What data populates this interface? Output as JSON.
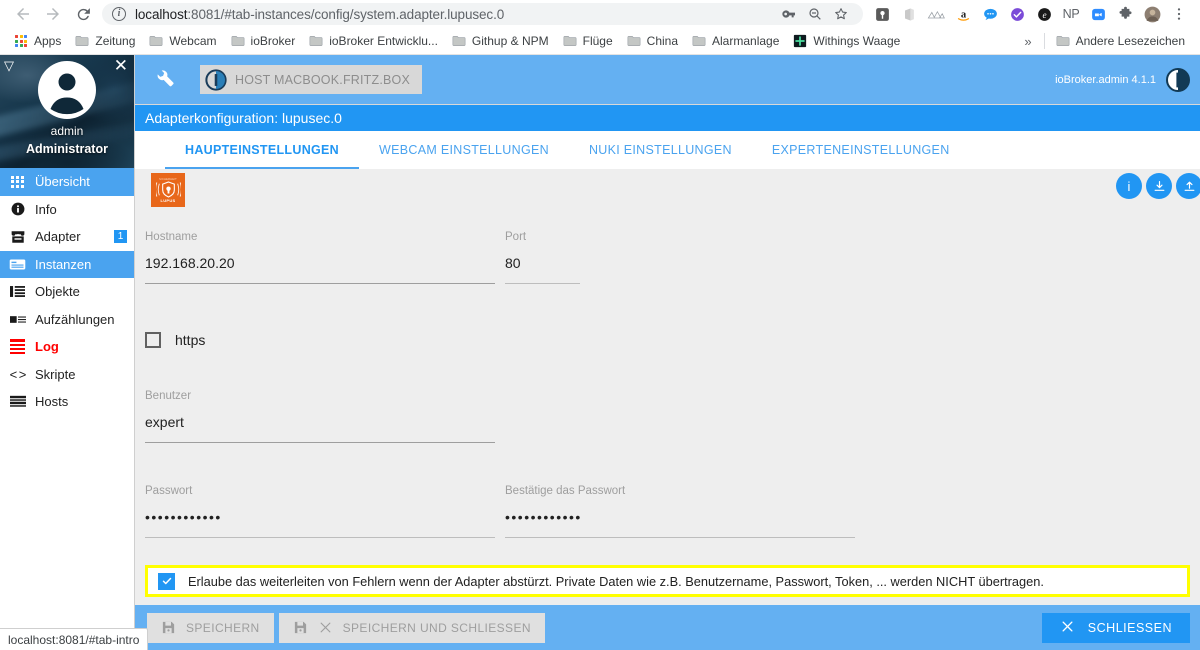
{
  "browser": {
    "nav": {
      "back": "←",
      "forward": "→",
      "reload": "⟳"
    },
    "url_prefix": "localhost",
    "url_suffix": ":8081/#tab-instances/config/system.adapter.lupusec.0",
    "omnibox_actions": [
      "key-icon",
      "zoom-out-icon",
      "bookmark-star-icon"
    ],
    "extensions": [
      "pocket-icon",
      "office-icon",
      "mountains-icon",
      "amazon-icon",
      "chat-bubble-icon",
      "check-circle-icon",
      "e-badge-icon",
      "np-icon",
      "zoom-video-icon",
      "puzzle-extension-icon",
      "profile-avatar-icon",
      "chrome-menu-icon"
    ],
    "bookmarks": [
      {
        "label": "Apps",
        "icon": "apps-grid-icon"
      },
      {
        "label": "Zeitung",
        "icon": "folder-icon"
      },
      {
        "label": "Webcam",
        "icon": "folder-icon"
      },
      {
        "label": "ioBroker",
        "icon": "folder-icon"
      },
      {
        "label": "ioBroker Entwicklu...",
        "icon": "folder-icon"
      },
      {
        "label": "Githup & NPM",
        "icon": "folder-icon"
      },
      {
        "label": "Flüge",
        "icon": "folder-icon"
      },
      {
        "label": "China",
        "icon": "folder-icon"
      },
      {
        "label": "Alarmanlage",
        "icon": "folder-icon"
      },
      {
        "label": "Withings Waage",
        "icon": "green-plus-icon"
      }
    ],
    "bookmarks_overflow": "»",
    "other_bookmarks": "Andere Lesezeichen",
    "status_text": "localhost:8081/#tab-intro"
  },
  "sidebar": {
    "collapse_icon": "▽",
    "close_icon": "✕",
    "user_name": "admin",
    "user_role": "Administrator",
    "items": [
      {
        "label": "Übersicht",
        "icon": "grid-icon",
        "state": "active"
      },
      {
        "label": "Info",
        "icon": "info-icon",
        "state": "normal"
      },
      {
        "label": "Adapter",
        "icon": "store-icon",
        "state": "normal",
        "badge": "1"
      },
      {
        "label": "Instanzen",
        "icon": "instances-icon",
        "state": "active"
      },
      {
        "label": "Objekte",
        "icon": "list-icon",
        "state": "normal"
      },
      {
        "label": "Aufzählungen",
        "icon": "enum-icon",
        "state": "normal"
      },
      {
        "label": "Log",
        "icon": "log-lines-icon",
        "state": "danger"
      },
      {
        "label": "Skripte",
        "icon": "code-brackets-icon",
        "state": "normal"
      },
      {
        "label": "Hosts",
        "icon": "hosts-icon",
        "state": "normal"
      }
    ]
  },
  "appbar": {
    "wrench_icon": "wrench-icon",
    "host_button": "HOST MACBOOK.FRITZ.BOX",
    "host_icon": "iobroker-logo-icon",
    "version": "ioBroker.admin 4.1.1",
    "logo_icon": "iobroker-logo-icon"
  },
  "config": {
    "title": "Adapterkonfiguration: lupusec.0",
    "tabs": [
      {
        "label": "HAUPTEINSTELLUNGEN",
        "active": true
      },
      {
        "label": "WEBCAM EINSTELLUNGEN",
        "active": false
      },
      {
        "label": "NUKI EINSTELLUNGEN",
        "active": false
      },
      {
        "label": "EXPERTENEINSTELLUNGEN",
        "active": false
      }
    ],
    "adapter_logo": {
      "top_text": "SICHERHEIT",
      "word": "LUPUS",
      "color": "#e8671a"
    },
    "circle_buttons": [
      "info-circle-icon",
      "download-circle-icon",
      "upload-circle-icon"
    ],
    "fields": {
      "hostname": {
        "label": "Hostname",
        "value": "192.168.20.20"
      },
      "port": {
        "label": "Port",
        "value": "80"
      },
      "https": {
        "label": "https",
        "checked": false
      },
      "benutzer": {
        "label": "Benutzer",
        "value": "expert"
      },
      "passwort": {
        "label": "Passwort",
        "value": "••••••••••••"
      },
      "passwort_bestaetigen": {
        "label": "Bestätige das Passwort",
        "value": "••••••••••••"
      }
    },
    "sentry": {
      "checked": true,
      "label": "Erlaube das weiterleiten von Fehlern wenn der Adapter abstürzt. Private Daten wie z.B. Benutzername, Passwort, Token, ... werden NICHT übertragen.",
      "highlight_color": "#ffff00"
    }
  },
  "footer": {
    "save": "SPEICHERN",
    "save_close": "SPEICHERN UND SCHLIESSEN",
    "close": "SCHLIESSEN",
    "save_icon": "floppy-disk-icon",
    "close_icon": "x-icon"
  },
  "colors": {
    "accent": "#2196f3",
    "appbar": "#64b0f2",
    "content_bg": "#eeeeee",
    "danger": "#ff0000",
    "lupus_orange": "#e8671a",
    "highlight": "#ffff00"
  }
}
